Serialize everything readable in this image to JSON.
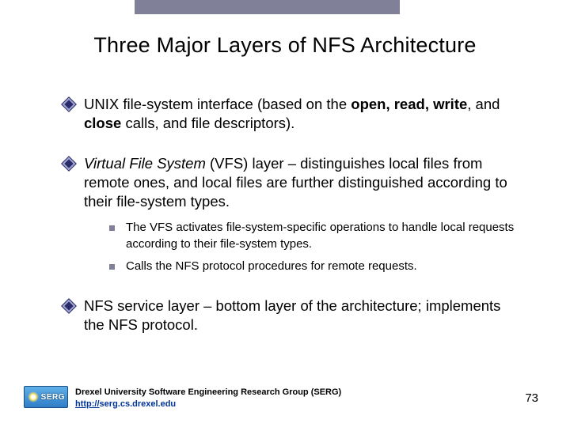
{
  "title": "Three Major Layers of NFS Architecture",
  "items": [
    {
      "html": "UNIX file-system interface (based on the <b>open, read, write</b>, and <b>close</b> calls, and file descriptors)."
    },
    {
      "html": "<i>Virtual File System</i> (VFS) layer – distinguishes local files from remote ones, and local files are further distinguished according to their file-system types.",
      "sub": [
        "The VFS activates file-system-specific operations to handle local requests according to their file-system types.",
        "Calls the NFS protocol procedures for remote requests."
      ]
    },
    {
      "html": "NFS service layer – bottom layer of the architecture; implements the NFS protocol."
    }
  ],
  "footer": {
    "org": "Drexel University Software Engineering Research Group (SERG)",
    "url_prefix": "http://",
    "url_rest": "serg.cs.drexel.edu"
  },
  "logo_text": "SERG",
  "page_number": "73"
}
